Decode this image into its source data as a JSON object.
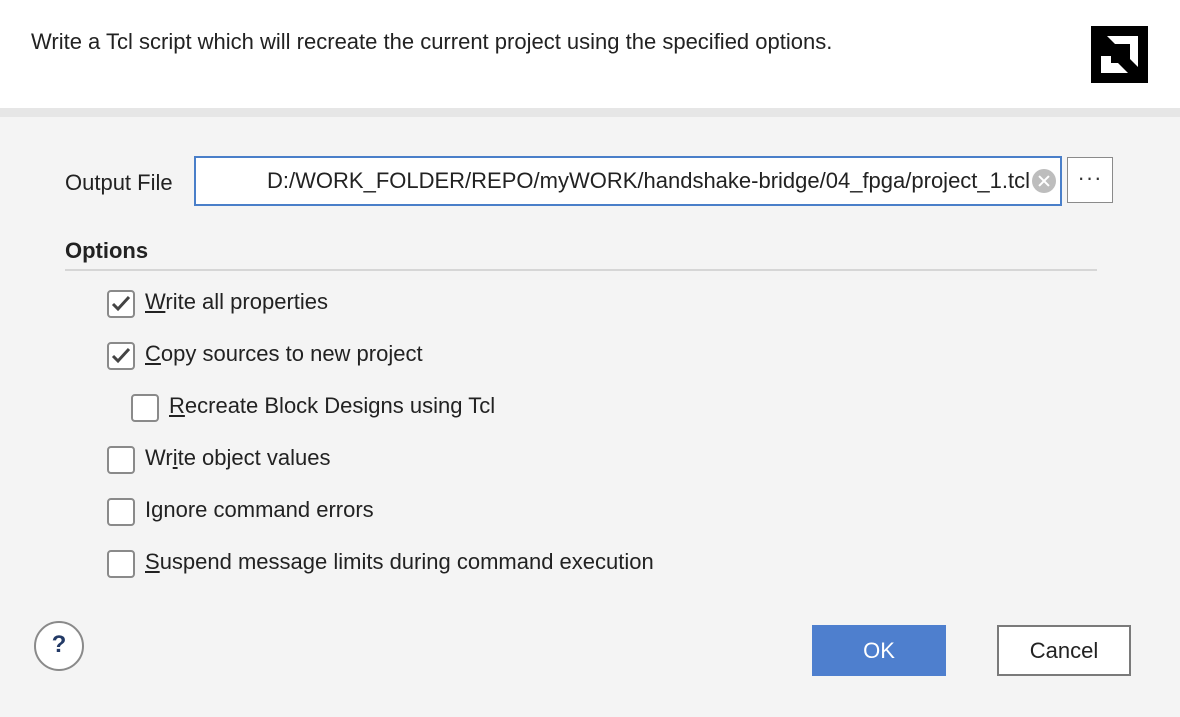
{
  "header": {
    "description": "Write a Tcl script which will recreate the current project using the specified options.",
    "logo_icon": "amd-logo-icon"
  },
  "output_file": {
    "label": "Output File",
    "value": "D:/WORK_FOLDER/REPO/myWORK/handshake-bridge/04_fpga/project_1.tcl",
    "clear_icon": "clear-circle-icon",
    "browse_label": "···"
  },
  "options": {
    "title": "Options",
    "items": [
      {
        "mnemonic": "W",
        "rest": "rite all properties",
        "checked": true
      },
      {
        "mnemonic": "C",
        "rest": "opy sources to new project",
        "checked": true
      },
      {
        "mnemonic": "R",
        "rest": "ecreate Block Designs using Tcl",
        "checked": false
      },
      {
        "pre": "Wr",
        "mnemonic": "i",
        "rest": "te object values",
        "checked": false
      },
      {
        "pre": "I",
        "mnemonic": "g",
        "rest": "nore command errors",
        "checked": false
      },
      {
        "mnemonic": "S",
        "rest": "uspend message limits during command execution",
        "checked": false
      }
    ]
  },
  "footer": {
    "help_label": "?",
    "ok_label": "OK",
    "cancel_label": "Cancel"
  },
  "colors": {
    "accent": "#4e7fce",
    "input_border": "#4a7fc9",
    "logo_bg": "#000000"
  }
}
